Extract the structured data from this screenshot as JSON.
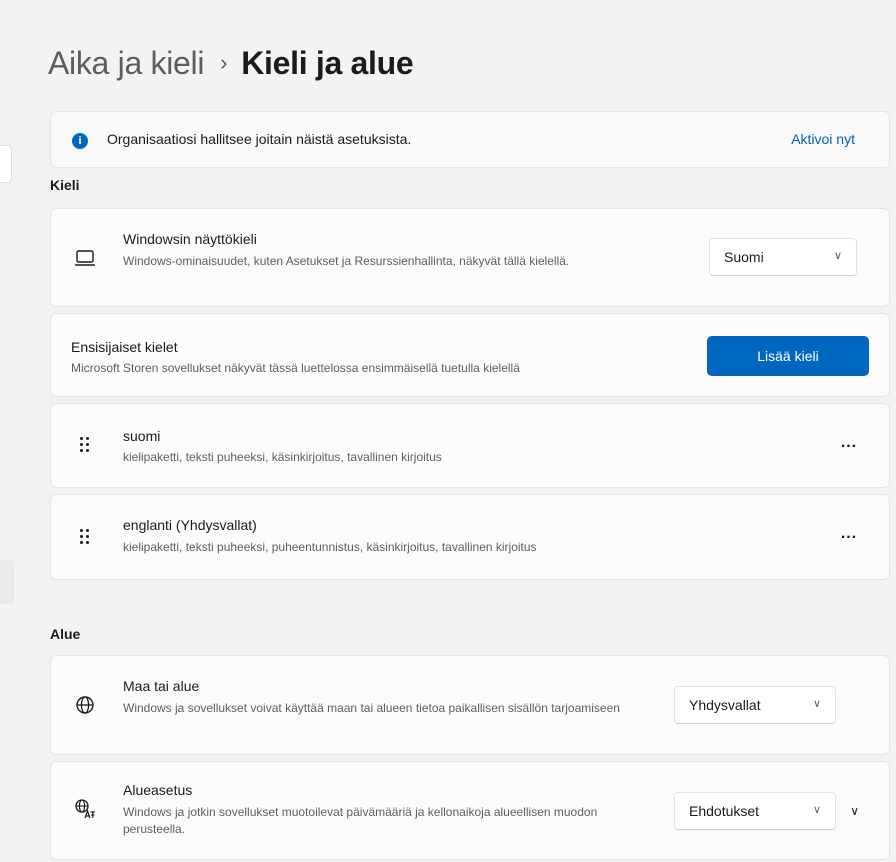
{
  "header": {
    "parent": "Aika ja kieli",
    "separator": "›",
    "current": "Kieli ja alue"
  },
  "info_bar": {
    "icon": "info-icon",
    "text": "Organisaatiosi hallitsee joitain näistä asetuksista.",
    "link": "Aktivoi nyt"
  },
  "language_section": {
    "title": "Kieli",
    "display_language": {
      "icon": "monitor-icon",
      "title": "Windowsin näyttökieli",
      "description": "Windows-ominaisuudet, kuten Asetukset ja Resurssienhallinta, näkyvät tällä kielellä.",
      "selected": "Suomi"
    },
    "preferred": {
      "title": "Ensisijaiset kielet",
      "description": "Microsoft Storen sovellukset näkyvät tässä luettelossa ensimmäisellä tuetulla kielellä",
      "button": "Lisää kieli"
    },
    "languages": [
      {
        "name": "suomi",
        "features": "kielipaketti, teksti puheeksi, käsinkirjoitus, tavallinen kirjoitus",
        "more": "..."
      },
      {
        "name": "englanti (Yhdysvallat)",
        "features": "kielipaketti, teksti puheeksi, puheentunnistus, käsinkirjoitus, tavallinen kirjoitus",
        "more": "..."
      }
    ]
  },
  "region_section": {
    "title": "Alue",
    "country": {
      "icon": "globe-icon",
      "title": "Maa tai alue",
      "description": "Windows ja sovellukset voivat käyttää maan tai alueen tietoa paikallisen sisällön tarjoamiseen",
      "selected": "Yhdysvallat"
    },
    "format": {
      "icon": "regional-format-icon",
      "title": "Alueasetus",
      "description": "Windows ja jotkin sovellukset muotoilevat päivämääriä ja kellonaikoja alueellisen muodon perusteella.",
      "selected": "Ehdotukset"
    }
  },
  "colors": {
    "accent": "#0067c0",
    "link": "#0060b8",
    "background": "#f3f3f3",
    "card": "#fbfbfb"
  }
}
